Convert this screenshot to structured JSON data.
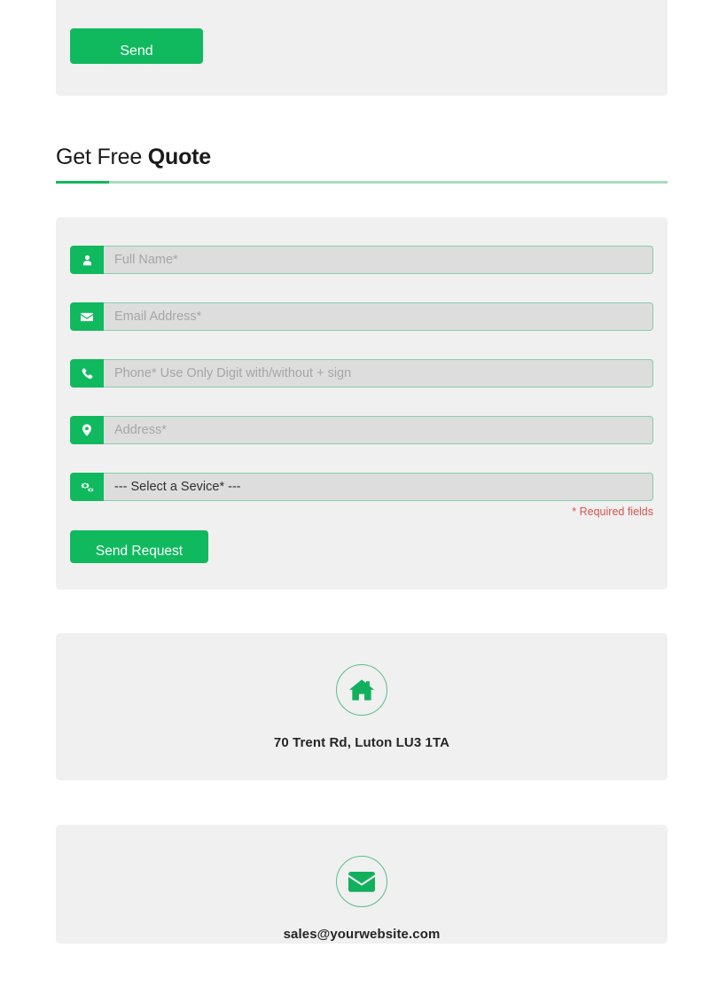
{
  "top_form": {
    "send_label": "Send"
  },
  "quote_section": {
    "title_light": "Get Free",
    "title_bold": "Quote",
    "accent_color": "#10b95e",
    "rule_color": "#a8dcbf"
  },
  "quote_form": {
    "fields": [
      {
        "icon": "user-icon",
        "placeholder": "Full Name*",
        "value": "",
        "name": "full-name"
      },
      {
        "icon": "envelope-icon",
        "placeholder": "Email Address*",
        "value": "",
        "name": "email-address"
      },
      {
        "icon": "phone-icon",
        "placeholder": "Phone* Use Only Digit with/without + sign",
        "value": "",
        "name": "phone"
      },
      {
        "icon": "map-marker-icon",
        "placeholder": "Address*",
        "value": "",
        "name": "address"
      }
    ],
    "service_select": {
      "icon": "cogs-icon",
      "selected": "--- Select a Sevice* ---",
      "options": [
        "--- Select a Sevice* ---"
      ]
    },
    "required_note": "* Required fields",
    "submit_label": "Send Request"
  },
  "contact_cards": [
    {
      "icon": "home-icon",
      "text": "70 Trent Rd, Luton LU3 1TA"
    },
    {
      "icon": "envelope-icon",
      "text": "sales@yourwebsite.com"
    }
  ]
}
